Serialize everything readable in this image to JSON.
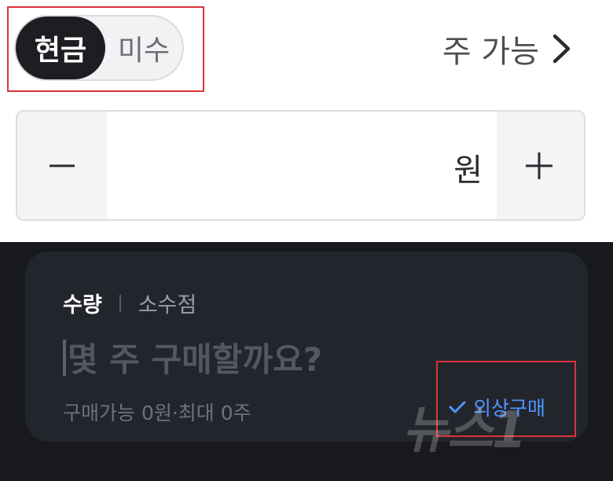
{
  "order_type": {
    "selected": "현금",
    "options": [
      "현금",
      "미수"
    ]
  },
  "available_link": {
    "label": "주 가능",
    "icon": "chevron-right-icon"
  },
  "amount_stepper": {
    "decrement_icon": "minus-icon",
    "increment_icon": "plus-icon",
    "value": "",
    "unit": "원"
  },
  "quantity_card": {
    "tabs": [
      {
        "label": "수량",
        "active": true
      },
      {
        "label": "소수점",
        "active": false
      }
    ],
    "placeholder": "몇 주 구매할까요?",
    "limit_text": "구매가능 0원·최대 0주",
    "overseas_option": {
      "label": "외상구매",
      "checked": true,
      "icon": "check-icon"
    }
  },
  "watermark": {
    "text": "뉴스1"
  },
  "colors": {
    "highlight": "#d9343a",
    "toggle_active_bg": "#1d1e22",
    "dark_bg": "#18191f",
    "card_bg": "#23252d",
    "accent_blue": "#4d95ff"
  }
}
